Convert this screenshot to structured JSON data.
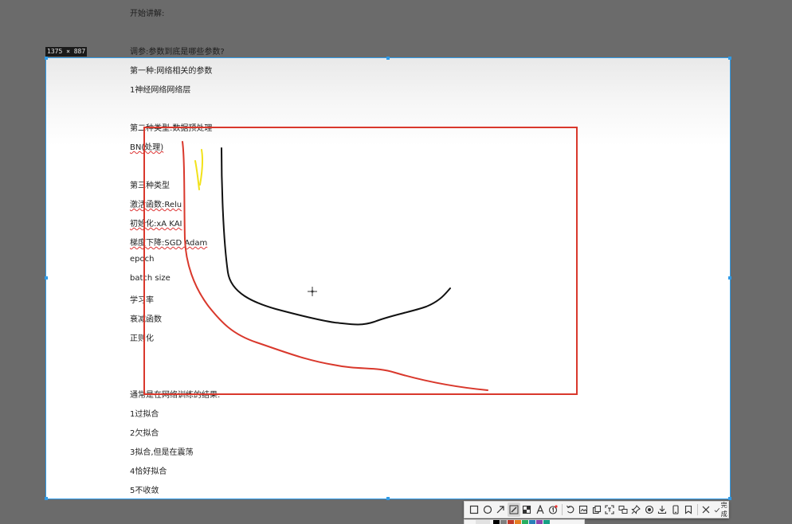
{
  "overlay": {
    "size_badge": "1375 × 887"
  },
  "document": {
    "dimmed_lines": [
      "开始讲解:",
      "调参:参数到底是哪些参数?"
    ],
    "lines": [
      "第一种:网络相关的参数",
      "1神经网络网络层",
      "第二种类型:数据预处理",
      "BN(处理)",
      "第三种类型",
      "激活函数:Relu",
      "初始化:xA KAI",
      "梯度下降:SGD  Adam",
      "epoch",
      "batch size",
      "学习率",
      "衰减函数",
      "正则化",
      "通常是在网络训练的结果:",
      "1过拟合",
      "2欠拟合",
      "3拟合,但是在震荡",
      "4恰好拟合",
      "5不收敛"
    ]
  },
  "annotations": {
    "rect_color": "#d9382c",
    "red_pen_color": "#d9382c",
    "black_pen_color": "#111111",
    "yellow_pen_color": "#f2e21a"
  },
  "toolbar": {
    "tools": [
      "rectangle-icon",
      "ellipse-icon",
      "arrow-icon",
      "pen-icon",
      "mosaic-icon",
      "text-icon",
      "number-marker-icon",
      "undo-icon",
      "save-icon",
      "copy-icon",
      "ocr-icon",
      "translate-icon",
      "pin-icon",
      "record-icon",
      "download-icon",
      "phone-icon",
      "bookmark-icon",
      "close-icon"
    ],
    "active_tool": "pen-icon",
    "done_label": "完成"
  },
  "palette": {
    "colors": [
      "#000000",
      "#7f7f7f",
      "#c0392b",
      "#e67e22",
      "#27ae60",
      "#2980b9",
      "#8e44ad",
      "#16a085"
    ]
  }
}
